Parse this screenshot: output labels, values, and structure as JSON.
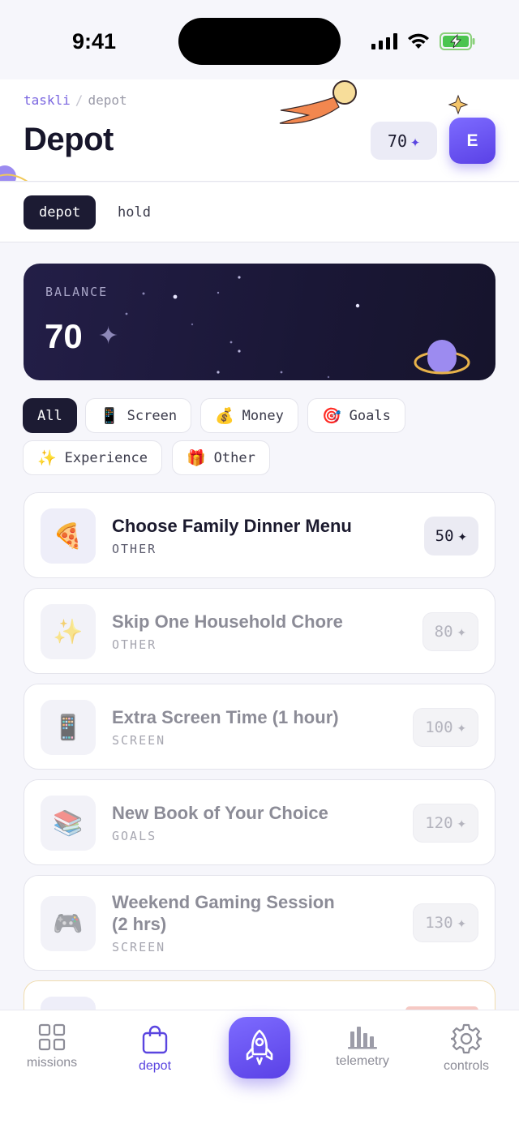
{
  "status": {
    "time": "9:41"
  },
  "header": {
    "app_name": "taskli",
    "crumb_sep": "/",
    "crumb_current": "depot",
    "title": "Depot",
    "balance": "70",
    "avatar_initial": "E"
  },
  "tabs": [
    {
      "label": "depot",
      "active": true
    },
    {
      "label": "hold",
      "active": false
    }
  ],
  "balance_card": {
    "label": "BALANCE",
    "value": "70"
  },
  "filters": [
    {
      "label": "All",
      "icon": "",
      "active": true
    },
    {
      "label": "Screen",
      "icon": "📱",
      "active": false
    },
    {
      "label": "Money",
      "icon": "💰",
      "active": false
    },
    {
      "label": "Goals",
      "icon": "🎯",
      "active": false
    },
    {
      "label": "Experience",
      "icon": "✨",
      "active": false
    },
    {
      "label": "Other",
      "icon": "🎁",
      "active": false
    }
  ],
  "rewards": [
    {
      "name": "Choose Family Dinner Menu",
      "category": "OTHER",
      "cost": "50",
      "icon": "🍕",
      "affordable": true
    },
    {
      "name": "Skip One Household Chore",
      "category": "OTHER",
      "cost": "80",
      "icon": "✨",
      "affordable": false
    },
    {
      "name": "Extra Screen Time (1 hour)",
      "category": "SCREEN",
      "cost": "100",
      "icon": "📱",
      "affordable": false
    },
    {
      "name": "New Book of Your Choice",
      "category": "GOALS",
      "cost": "120",
      "icon": "📚",
      "affordable": false
    },
    {
      "name_line1": "Weekend Gaming Session",
      "name_line2": "(2 hrs)",
      "category": "SCREEN",
      "cost": "130",
      "icon": "🎮",
      "affordable": false
    }
  ],
  "nav": {
    "missions": "missions",
    "depot": "depot",
    "telemetry": "telemetry",
    "controls": "controls"
  },
  "colors": {
    "accent": "#5a45e0",
    "dark": "#1c1b33",
    "card": "#1a1736"
  }
}
